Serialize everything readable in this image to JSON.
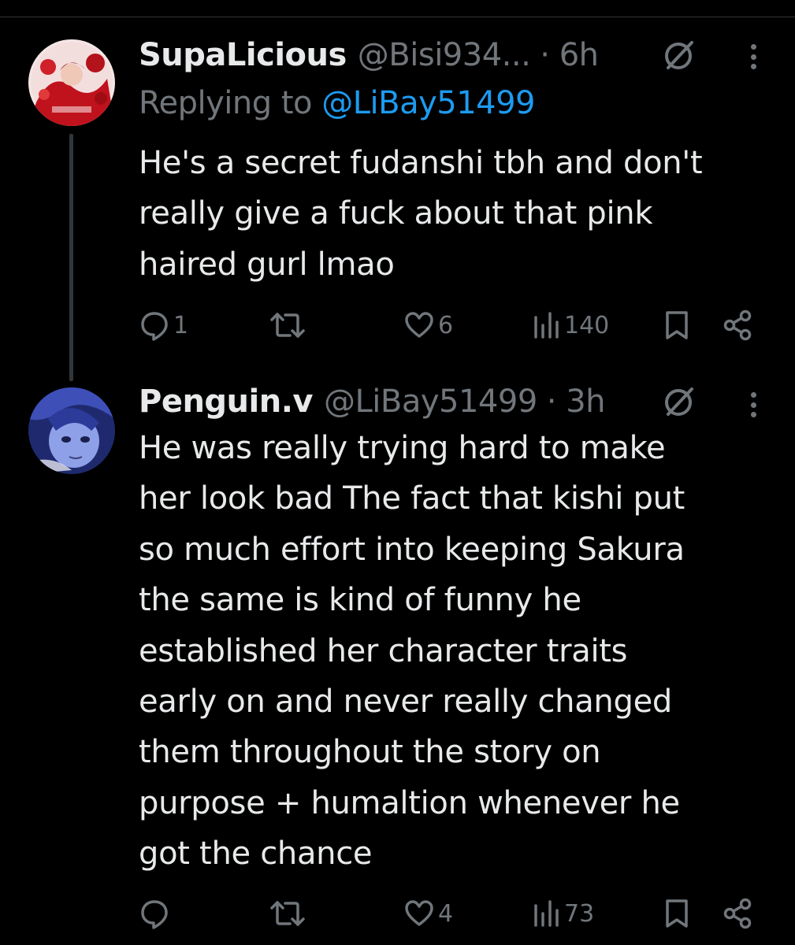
{
  "tweets": [
    {
      "display_name": "SupaLicious",
      "handle": "@Bisi934...",
      "time": "· 6h",
      "replying_label": "Replying to",
      "replying_to": "@LiBay51499",
      "text": "He's a secret fudanshi tbh and don't\nreally give a fuck about that pink\nhaired gurl lmao",
      "counts": {
        "replies": "1",
        "retweets": "",
        "likes": "6",
        "views": "140"
      },
      "avatar_icon": "red-anime-avatar"
    },
    {
      "display_name": "Penguin.v",
      "handle": "@LiBay51499",
      "time": "· 3h",
      "text": "He was really trying hard to make\nher look bad The fact that kishi put\nso much effort into keeping Sakura\nthe same is kind of funny he\nestablished her character traits\nearly on and never really changed\nthem throughout the story on\npurpose + humaltion  whenever he\ngot the chance",
      "counts": {
        "replies": "",
        "retweets": "",
        "likes": "4",
        "views": "73"
      },
      "avatar_icon": "blue-anime-avatar"
    }
  ],
  "icons": {
    "reply": "reply-icon",
    "retweet": "retweet-icon",
    "like": "heart-icon",
    "views": "views-icon",
    "bookmark": "bookmark-icon",
    "share": "share-icon",
    "grok": "grok-icon",
    "more": "more-icon"
  },
  "colors": {
    "background": "#000000",
    "text": "#e7e9ea",
    "muted": "#71767b",
    "link": "#1d9bf0"
  }
}
